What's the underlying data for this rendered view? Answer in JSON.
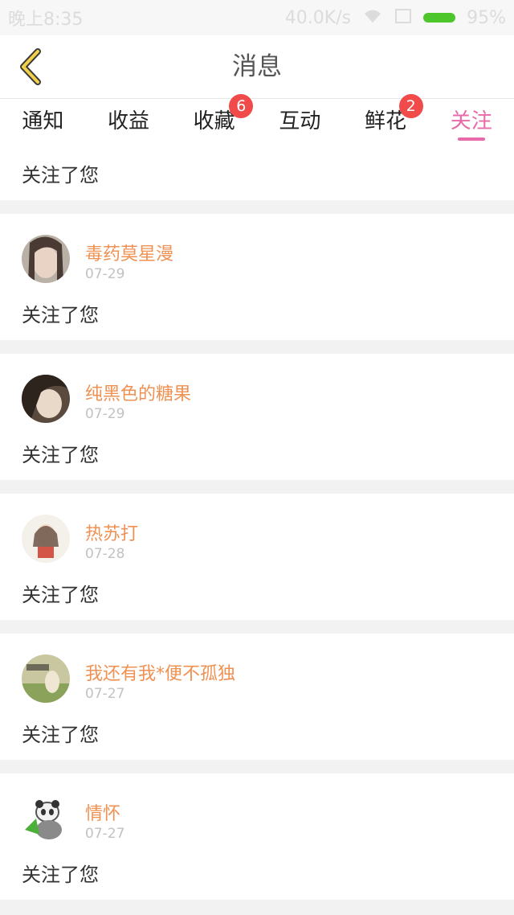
{
  "status_bar": {
    "time": "晚上8:35",
    "speed": "40.0K/s",
    "battery": "95%"
  },
  "header": {
    "title": "消息",
    "back_icon": "chevron-left-icon",
    "accent_color": "#e7c03a"
  },
  "tabs": [
    {
      "label": "通知",
      "badge": ""
    },
    {
      "label": "收益",
      "badge": ""
    },
    {
      "label": "收藏",
      "badge": "6"
    },
    {
      "label": "互动",
      "badge": ""
    },
    {
      "label": "鲜花",
      "badge": "2"
    },
    {
      "label": "关注",
      "badge": "",
      "active": true
    }
  ],
  "partial_item": {
    "message": "关注了您"
  },
  "items": [
    {
      "name": "毒药莫星漫",
      "date": "07-29",
      "message": "关注了您"
    },
    {
      "name": "纯黑色的糖果",
      "date": "07-29",
      "message": "关注了您"
    },
    {
      "name": "热苏打",
      "date": "07-28",
      "message": "关注了您"
    },
    {
      "name": "我还有我*便不孤独",
      "date": "07-27",
      "message": "关注了您"
    },
    {
      "name": "情怀",
      "date": "07-27",
      "message": "关注了您"
    }
  ],
  "colors": {
    "active_tab": "#e86aa8",
    "name": "#ef9153",
    "badge": "#f04a4a"
  }
}
